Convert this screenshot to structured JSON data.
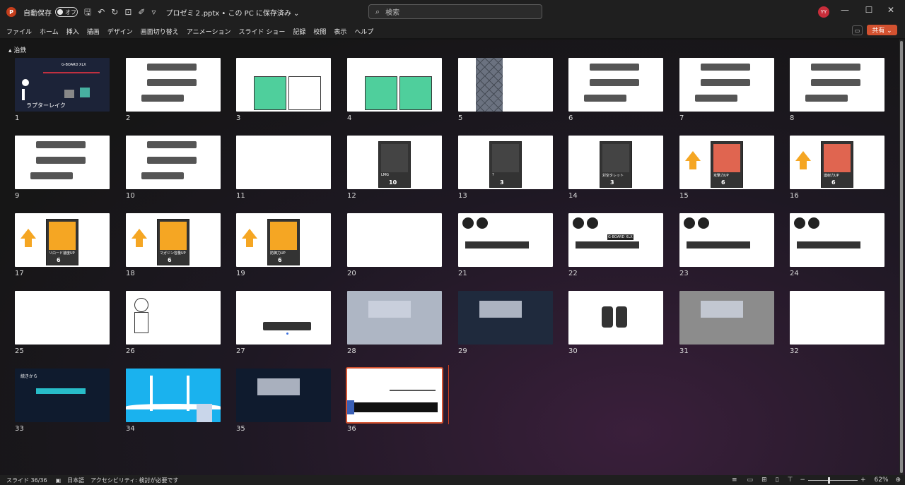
{
  "titlebar": {
    "app_icon": "P",
    "autosave_label": "自動保存",
    "toggle_label": "オフ",
    "qa_save_icon": "🖫",
    "qa_undo_icon": "↶",
    "qa_redo_icon": "↻",
    "qa_present_icon": "⊡",
    "qa_draw_icon": "✐",
    "qa_more_icon": "▿",
    "filename": "プロゼミ２.pptx • この PC に保存済み ⌄",
    "search_placeholder": "検索",
    "search_icon": "⌕",
    "user_initials": "YY",
    "minimize": "—",
    "maximize": "☐",
    "close": "✕"
  },
  "menu": [
    "ファイル",
    "ホーム",
    "挿入",
    "描画",
    "デザイン",
    "画面切り替え",
    "アニメーション",
    "スライド ショー",
    "記録",
    "校閲",
    "表示",
    "ヘルプ"
  ],
  "share": {
    "label": "共有 ⌄",
    "comment_icon": "▭"
  },
  "section": {
    "label": "▴ 治鉄"
  },
  "accent_color": "#d35230",
  "slides": [
    {
      "num": "1",
      "bg": "#1c2338",
      "title": "ラプターレイク",
      "brand": "G-BOARD XLX"
    },
    {
      "num": "2",
      "bg": "#ffffff"
    },
    {
      "num": "3",
      "bg": "#ffffff"
    },
    {
      "num": "4",
      "bg": "#ffffff"
    },
    {
      "num": "5",
      "bg": "#ffffff"
    },
    {
      "num": "6",
      "bg": "#ffffff"
    },
    {
      "num": "7",
      "bg": "#ffffff"
    },
    {
      "num": "8",
      "bg": "#ffffff"
    },
    {
      "num": "9",
      "bg": "#ffffff"
    },
    {
      "num": "10",
      "bg": "#ffffff"
    },
    {
      "num": "11",
      "bg": "#ffffff"
    },
    {
      "num": "12",
      "bg": "#ffffff",
      "card": "LMG",
      "price": "10"
    },
    {
      "num": "13",
      "bg": "#ffffff",
      "card": "?",
      "price": "3"
    },
    {
      "num": "14",
      "bg": "#ffffff",
      "card": "対空タレット",
      "price": "3"
    },
    {
      "num": "15",
      "bg": "#ffffff",
      "card": "攻撃力UP",
      "price": "6"
    },
    {
      "num": "16",
      "bg": "#ffffff",
      "card": "連射力UP",
      "price": "6"
    },
    {
      "num": "17",
      "bg": "#ffffff",
      "card": "リロード速度UP",
      "price": "6"
    },
    {
      "num": "18",
      "bg": "#ffffff",
      "card": "マガジン容量UP",
      "price": "6"
    },
    {
      "num": "19",
      "bg": "#ffffff",
      "card": "防御力UP",
      "price": "6"
    },
    {
      "num": "20",
      "bg": "#ffffff"
    },
    {
      "num": "21",
      "bg": "#ffffff"
    },
    {
      "num": "22",
      "bg": "#ffffff",
      "brand": "G-BOARD XLX"
    },
    {
      "num": "23",
      "bg": "#ffffff"
    },
    {
      "num": "24",
      "bg": "#ffffff"
    },
    {
      "num": "25",
      "bg": "#ffffff"
    },
    {
      "num": "26",
      "bg": "#ffffff"
    },
    {
      "num": "27",
      "bg": "#ffffff"
    },
    {
      "num": "28",
      "bg": "#aeb6c4"
    },
    {
      "num": "29",
      "bg": "#1f2a3d"
    },
    {
      "num": "30",
      "bg": "#ffffff"
    },
    {
      "num": "31",
      "bg": "#8c8c8c"
    },
    {
      "num": "32",
      "bg": "#ffffff"
    },
    {
      "num": "33",
      "bg": "#0f1b2e",
      "title": "続きから"
    },
    {
      "num": "34",
      "bg": "#1ab2ee"
    },
    {
      "num": "35",
      "bg": "#0f1b2e"
    },
    {
      "num": "36",
      "bg": "#ffffff"
    }
  ],
  "status": {
    "slide_count": "スライド 36/36",
    "language": "日本語",
    "accessibility": "アクセシビリティ: 検討が必要です",
    "zoom": "62%",
    "zoom_minus": "−",
    "zoom_plus": "+",
    "notes_icon": "≡",
    "view_normal_icon": "▭",
    "view_sorter_icon": "⊞",
    "view_reading_icon": "▯",
    "view_show_icon": "⊤",
    "fit_icon": "⊕"
  }
}
